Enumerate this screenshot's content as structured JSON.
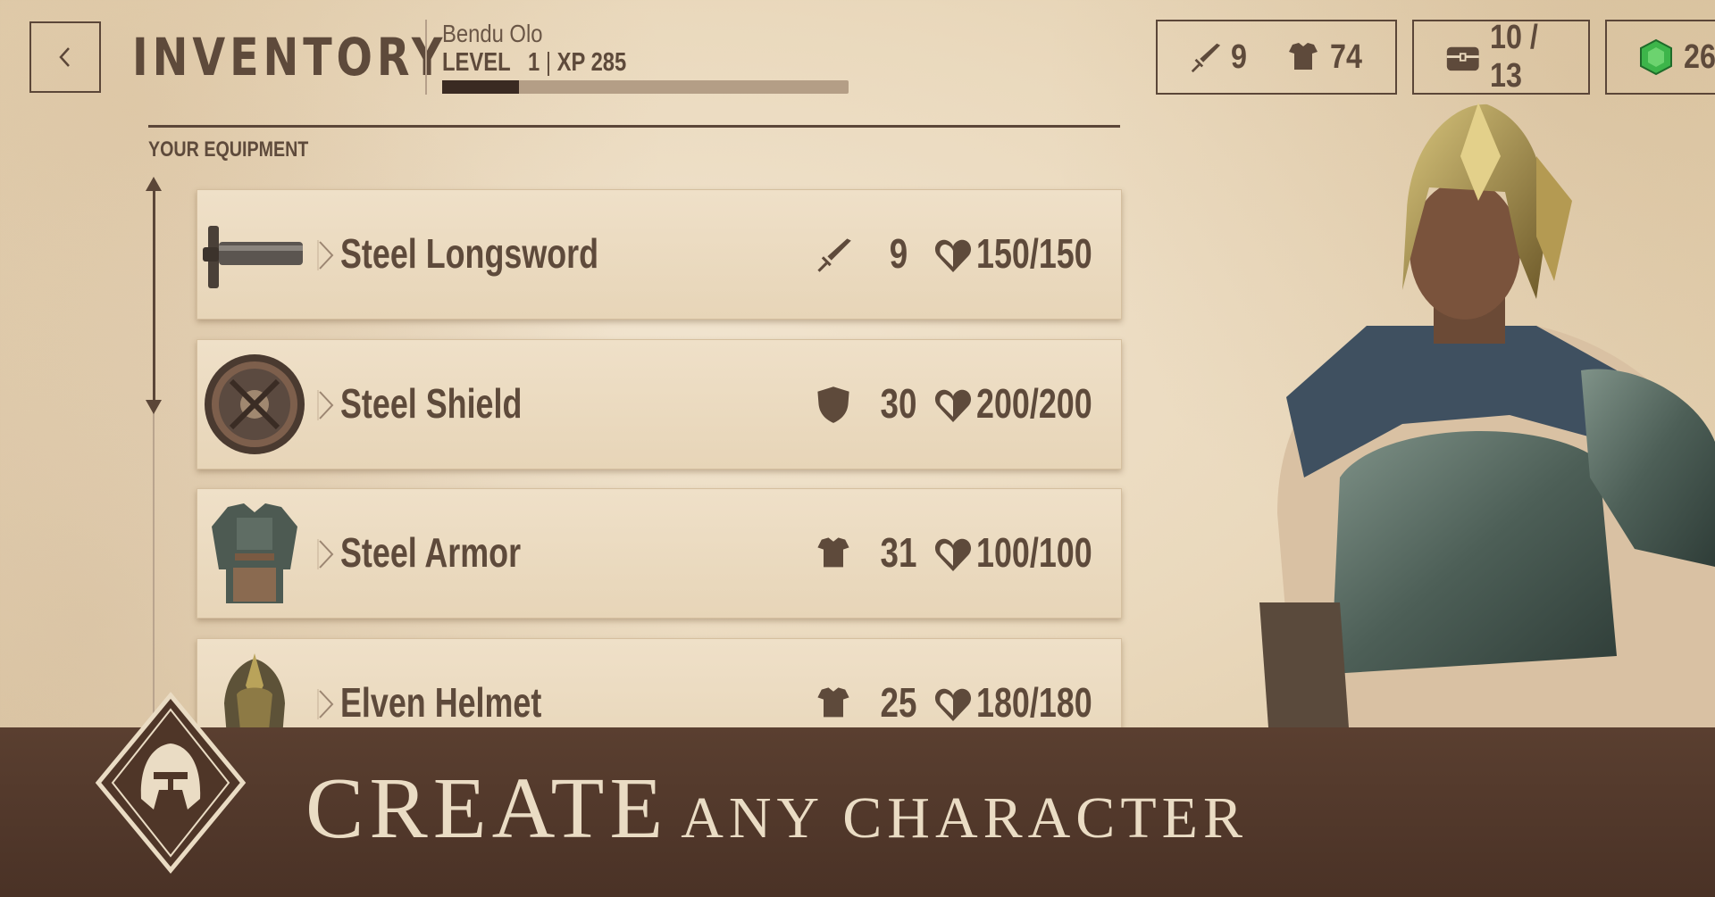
{
  "header": {
    "title": "INVENTORY",
    "player_name": "Bendu Olo",
    "level_label": "LEVEL",
    "level_value": "1",
    "xp_label": "XP 285",
    "xp_progress": 0.19
  },
  "stats": {
    "attack": "9",
    "armor": "74",
    "inventory": "10 / 13",
    "gems": "26"
  },
  "equipment": {
    "section_label": "YOUR EQUIPMENT",
    "items": [
      {
        "name": "Steel Longsword",
        "stat": "9",
        "stat_icon": "sword-icon",
        "durability": "150/150",
        "thumb": "longsword"
      },
      {
        "name": "Steel Shield",
        "stat": "30",
        "stat_icon": "shield-icon",
        "durability": "200/200",
        "thumb": "shield"
      },
      {
        "name": "Steel Armor",
        "stat": "31",
        "stat_icon": "armor-icon",
        "durability": "100/100",
        "thumb": "armor"
      },
      {
        "name": "Elven Helmet",
        "stat": "25",
        "stat_icon": "armor-icon",
        "durability": "180/180",
        "thumb": "helmet"
      }
    ]
  },
  "banner": {
    "headline": "CREATE",
    "subline": "ANY CHARACTER"
  },
  "colors": {
    "ink": "#5e4a3b",
    "parchment": "#ead9bd",
    "banner": "#4f3628",
    "gem": "#3db54a"
  }
}
